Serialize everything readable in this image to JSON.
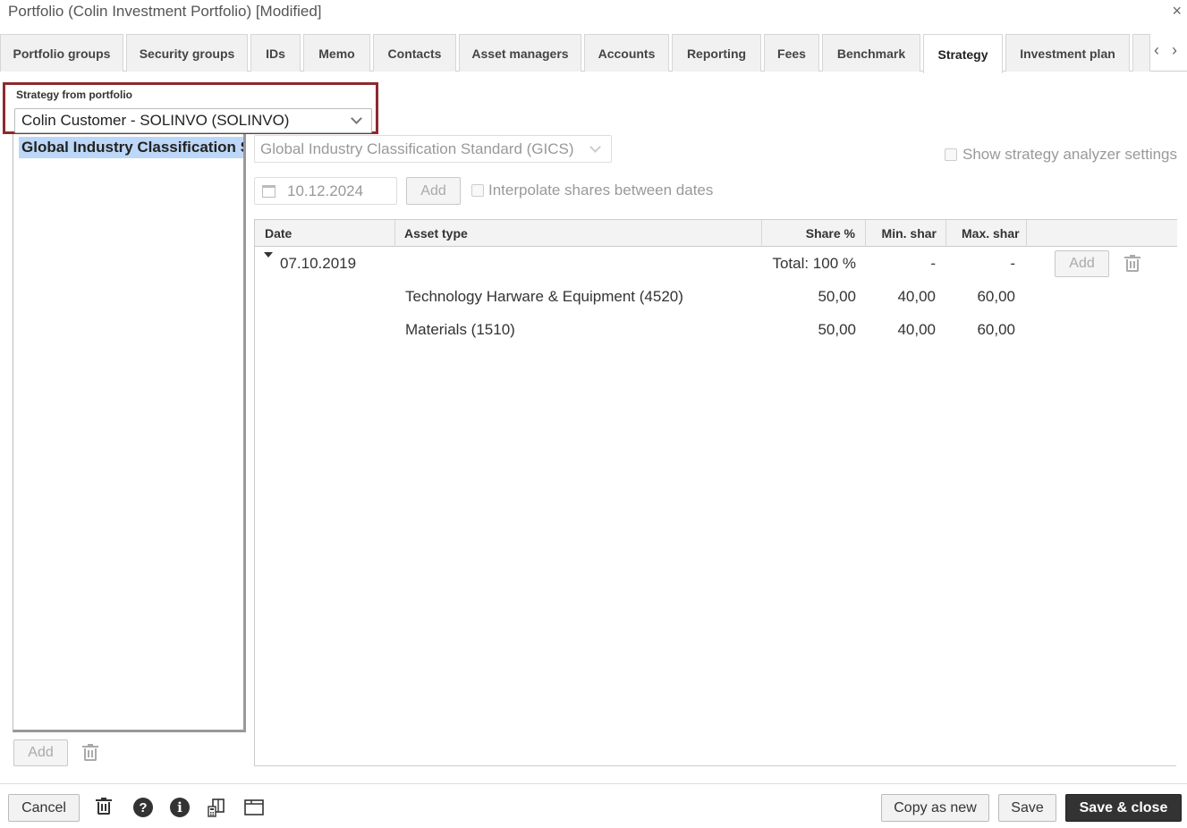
{
  "window": {
    "title": "Portfolio (Colin Investment Portfolio) [Modified]",
    "close_glyph": "×"
  },
  "tabs": [
    {
      "label": "Portfolio groups"
    },
    {
      "label": "Security groups"
    },
    {
      "label": "IDs"
    },
    {
      "label": "Memo"
    },
    {
      "label": "Contacts"
    },
    {
      "label": "Asset managers"
    },
    {
      "label": "Accounts"
    },
    {
      "label": "Reporting"
    },
    {
      "label": "Fees"
    },
    {
      "label": "Benchmark"
    },
    {
      "label": "Strategy",
      "active": true
    },
    {
      "label": "Investment plan"
    }
  ],
  "tab_nav": {
    "prev": "‹",
    "next": "›"
  },
  "strategy_from_portfolio": {
    "label": "Strategy from portfolio",
    "value": "Colin Customer - SOLINVO (SOLINVO)"
  },
  "left_list": {
    "items": [
      "Global Industry Classification Standard (GICS)"
    ],
    "add_label": "Add"
  },
  "classification": {
    "value": "Global Industry Classification Standard (GICS)"
  },
  "analyzer": {
    "label": "Show strategy analyzer settings"
  },
  "date_row": {
    "date": "10.12.2024",
    "add_label": "Add",
    "interpolate_label": "Interpolate shares between dates"
  },
  "table": {
    "headers": {
      "date": "Date",
      "asset_type": "Asset type",
      "share": "Share %",
      "min": "Min. shar",
      "max": "Max. shar"
    },
    "groups": [
      {
        "date": "07.10.2019",
        "total": "Total: 100 %",
        "min": "-",
        "max": "-",
        "add_label": "Add",
        "rows": [
          {
            "asset_type": "Technology Harware & Equipment (4520)",
            "share": "50,00",
            "min": "40,00",
            "max": "60,00"
          },
          {
            "asset_type": "Materials (1510)",
            "share": "50,00",
            "min": "40,00",
            "max": "60,00"
          }
        ]
      }
    ]
  },
  "footer": {
    "cancel": "Cancel",
    "copy_as_new": "Copy as new",
    "save": "Save",
    "save_close": "Save & close",
    "help_glyph": "?",
    "info_glyph": "i"
  },
  "colors": {
    "highlight_border": "#8d2a2e",
    "selection": "#bcd7f7",
    "primary_button": "#333333"
  }
}
